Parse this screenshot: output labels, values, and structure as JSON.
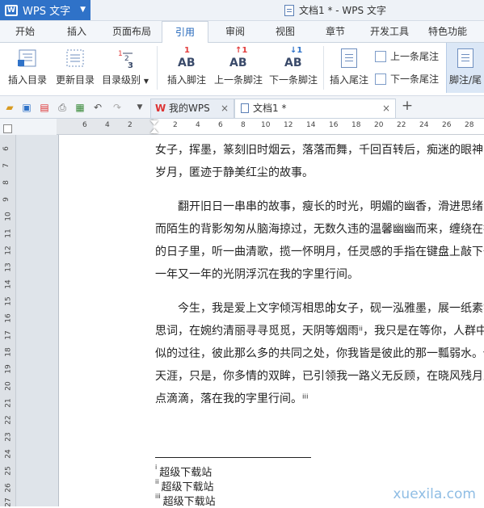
{
  "app": {
    "name": "WPS 文字",
    "logo_letter": "W",
    "window_title": "文档1 * - WPS 文字"
  },
  "tabs": [
    {
      "label": "开始"
    },
    {
      "label": "插入"
    },
    {
      "label": "页面布局"
    },
    {
      "label": "引用"
    },
    {
      "label": "审阅"
    },
    {
      "label": "视图"
    },
    {
      "label": "章节"
    },
    {
      "label": "开发工具"
    },
    {
      "label": "特色功能"
    }
  ],
  "active_tab": "引用",
  "ribbon": {
    "insert_toc": "插入目录",
    "update_toc": "更新目录",
    "toc_level": "目录级别",
    "insert_footnote": "插入脚注",
    "prev_footnote": "上一条脚注",
    "next_footnote": "下一条脚注",
    "insert_endnote": "插入尾注",
    "prev_endnote": "上一条尾注",
    "next_endnote": "下一条尾注",
    "footnote_endnote": "脚注/尾"
  },
  "doc_tabs": [
    {
      "label": "我的WPS"
    },
    {
      "label": "文档1 *"
    }
  ],
  "ruler": {
    "h_left": [
      "6",
      "4",
      "2"
    ],
    "h_right": [
      "2",
      "4",
      "6",
      "8",
      "10",
      "12",
      "14",
      "16",
      "18",
      "20",
      "22",
      "24",
      "26",
      "28"
    ],
    "v": [
      "6",
      "7",
      "8",
      "9",
      "10",
      "11",
      "12",
      "13",
      "14",
      "15",
      "16",
      "17",
      "18",
      "19",
      "20",
      "21",
      "22",
      "23",
      "24",
      "25",
      "26",
      "27"
    ]
  },
  "document": {
    "lines": [
      "女子，挥墨，篆刻旧时烟云，落落而舞，千回百转后，痴迷的眼神，",
      "岁月，匿迹于静美红尘的故事。",
      "　　翻开旧日一串串的故事，瘦长的时光，明媚的幽香，滑进思绪中",
      "而陌生的背影匆匆从脑海掠过，无数久违的温馨幽幽而来，缠绕在指",
      "的日子里，听一曲清歌，揽一怀明月，任灵感的手指在键盘上敲下一",
      "一年又一年的光阴浮沉在我的字里行间。",
      "　　今生，我是爱上文字倾泻相思的女子，砚一泓雅墨，展一纸素笺",
      "思词，在婉约清丽寻寻觅觅，天阴等烟雨ⁱⁱ，我只是在等你，人群中",
      "似的过往，彼此那么多的共同之处，你我皆是彼此的那一瓢弱水。你",
      "天涯，只是，你多情的双眸，已引领我一路义无反顾，在晓风残月里",
      "点滴滴，落在我的字里行间。ⁱⁱⁱ"
    ],
    "footnotes": [
      {
        "mark": "i",
        "text": "超级下载站"
      },
      {
        "mark": "ii",
        "text": "超级下载站"
      },
      {
        "mark": "iii",
        "text": "超级下载站"
      }
    ]
  },
  "watermark": "xuexila.com",
  "colors": {
    "accent": "#2f72c8",
    "active_tab_text": "#2266bb",
    "watermark": "#8fbde4"
  }
}
